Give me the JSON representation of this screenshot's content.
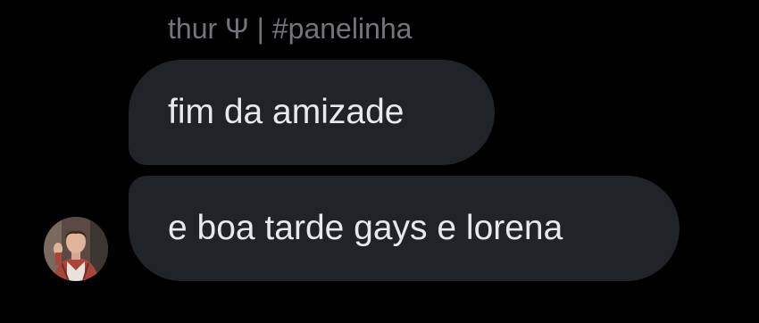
{
  "conversation": {
    "sender_name": "thur Ψ | #panelinha",
    "messages": [
      {
        "text": "fim da amizade"
      },
      {
        "text": "e boa tarde gays e lorena"
      }
    ],
    "avatar_icon": "user-avatar-photo"
  },
  "colors": {
    "background": "#000000",
    "bubble": "#202327",
    "text": "#e7e9ea",
    "meta_text": "#71767b"
  }
}
